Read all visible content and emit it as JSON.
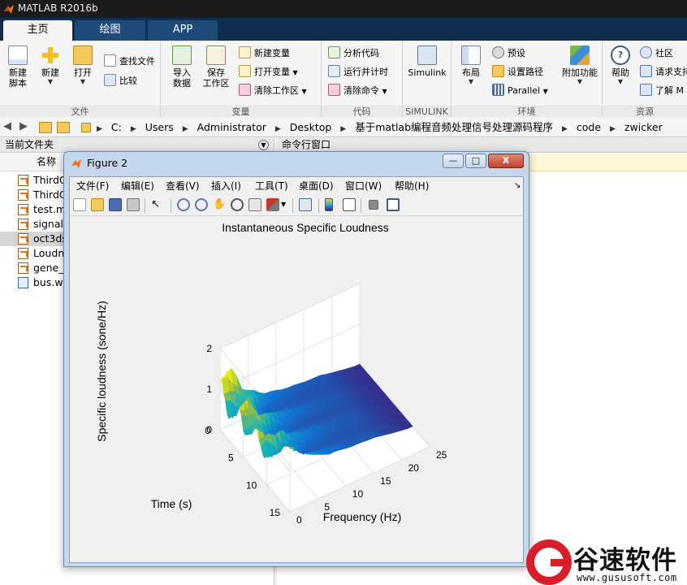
{
  "app": {
    "title": "MATLAB R2016b"
  },
  "tabs": [
    {
      "label": "主页"
    },
    {
      "label": "绘图"
    },
    {
      "label": "APP"
    }
  ],
  "ribbon": {
    "file": {
      "label": "文件",
      "new_script": "新建\n脚本",
      "new_script_l1": "新建",
      "new_script_l2": "脚本",
      "new": "新建",
      "open": "打开",
      "find_files": "查找文件",
      "compare": "比较"
    },
    "variable": {
      "label": "变量",
      "import_l1": "导入",
      "import_l2": "数据",
      "save_l1": "保存",
      "save_l2": "工作区",
      "new_var": "新建变量",
      "open_var": "打开变量",
      "clear_ws": "清除工作区"
    },
    "code": {
      "label": "代码",
      "analyze": "分析代码",
      "run_time": "运行并计时",
      "clear_cmd": "清除命令"
    },
    "simulink": {
      "label": "SIMULINK",
      "btn": "Simulink"
    },
    "env": {
      "label": "环境",
      "layout": "布局",
      "prefs": "预设",
      "set_path": "设置路径",
      "parallel": "Parallel",
      "addons": "附加功能"
    },
    "resources": {
      "label": "资源",
      "help": "帮助",
      "community": "社区",
      "request": "请求支持",
      "learn": "了解 M"
    }
  },
  "address": {
    "crumbs": [
      "C:",
      "Users",
      "Administrator",
      "Desktop",
      "基于matlab编程音频处理信号处理源码程序",
      "code",
      "zwicker"
    ]
  },
  "left_panel": {
    "title": "当前文件夹",
    "col_name": "名称",
    "files": [
      {
        "name": "ThirdO",
        "type": "m"
      },
      {
        "name": "ThirdO",
        "type": "m"
      },
      {
        "name": "test.m",
        "type": "m"
      },
      {
        "name": "signal",
        "type": "m"
      },
      {
        "name": "oct3ds",
        "type": "m",
        "selected": true
      },
      {
        "name": "Loudn",
        "type": "m"
      },
      {
        "name": "gene_s",
        "type": "m"
      },
      {
        "name": "bus.wa",
        "type": "wav"
      }
    ]
  },
  "right_panel": {
    "title": "命令行窗口"
  },
  "figure": {
    "title": "Figure 2",
    "menu": [
      "文件(F)",
      "编辑(E)",
      "查看(V)",
      "插入(I)",
      "工具(T)",
      "桌面(D)",
      "窗口(W)",
      "帮助(H)"
    ],
    "controls": {
      "minimize": "—",
      "maximize": "□",
      "close": "X"
    }
  },
  "chart_data": {
    "type": "surface3d",
    "title": "Instantaneous Specific Loudness",
    "xlabel": "Frequency (Hz)",
    "ylabel": "Time (s)",
    "zlabel": "Specific loudness (sone/Hz)",
    "x_ticks": [
      0,
      5,
      10,
      15,
      20,
      25
    ],
    "y_ticks": [
      0,
      5,
      10,
      15
    ],
    "z_ticks": [
      0,
      1,
      2
    ],
    "xlim": [
      0,
      25
    ],
    "ylim": [
      0,
      15
    ],
    "zlim": [
      0,
      2
    ],
    "colormap": "parula",
    "grid": true
  },
  "watermark": {
    "text": "谷速软件",
    "url": "www.gususoft.com"
  },
  "colors": {
    "ribbon_tab_bg": "#0f2d4f",
    "accent": "#1d4a78",
    "watermark_red": "#d81e28"
  }
}
